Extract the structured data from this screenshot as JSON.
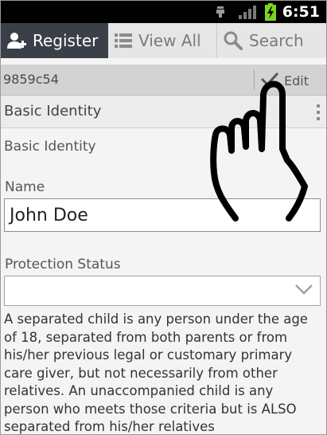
{
  "status_bar": {
    "time": "6:51",
    "icons": [
      "usb-debug-icon",
      "signal-icon",
      "battery-charging-icon"
    ]
  },
  "tabs": [
    {
      "label": "Register",
      "icon": "add-user-icon",
      "active": true
    },
    {
      "label": "View All",
      "icon": "list-icon",
      "active": false
    },
    {
      "label": "Search",
      "icon": "search-icon",
      "active": false
    }
  ],
  "record": {
    "id": "9859c54",
    "edit_label": "Edit"
  },
  "section": {
    "title": "Basic Identity",
    "subtitle": "Basic Identity"
  },
  "form": {
    "name_label": "Name",
    "name_value": "John Doe",
    "protection_label": "Protection Status",
    "protection_value": "",
    "description": "A separated child is any person under the age of 18, separated from both parents or from his/her previous legal or customary primary care giver, but not necessarily from other relatives. An unaccompanied child is any person who meets those criteria but is ALSO separated from his/her relatives"
  },
  "colors": {
    "status_bar": "#000000",
    "active_tab": "#3b3f47",
    "tab_bar": "#e6e6e6",
    "id_bar": "#d3d3d3",
    "battery": "#7ed321"
  }
}
